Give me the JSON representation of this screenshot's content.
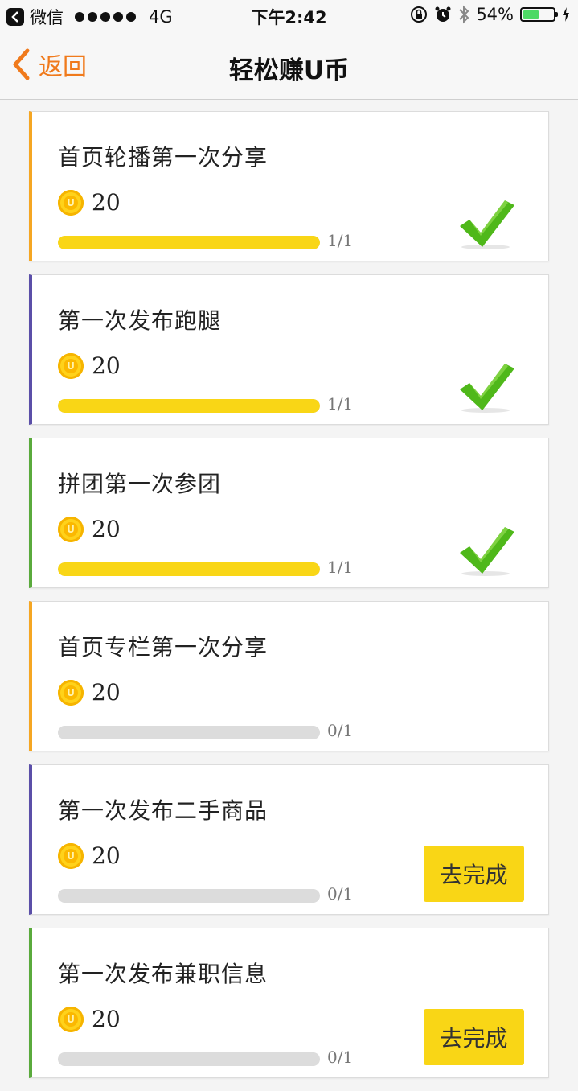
{
  "status_bar": {
    "app": "微信",
    "network": "4G",
    "time": "下午2:42",
    "battery": "54%",
    "battery_level": 0.54
  },
  "nav": {
    "back_label": "返回",
    "title": "轻松赚U币"
  },
  "tasks": [
    {
      "title": "首页轮播第一次分享",
      "reward": "20",
      "progress_text": "1/1",
      "progress": 1,
      "done": true,
      "accent": "#f5a623",
      "button": ""
    },
    {
      "title": "第一次发布跑腿",
      "reward": "20",
      "progress_text": "1/1",
      "progress": 1,
      "done": true,
      "accent": "#5b4fa8",
      "button": ""
    },
    {
      "title": "拼团第一次参团",
      "reward": "20",
      "progress_text": "1/1",
      "progress": 1,
      "done": true,
      "accent": "#5aaa3c",
      "button": ""
    },
    {
      "title": "首页专栏第一次分享",
      "reward": "20",
      "progress_text": "0/1",
      "progress": 0,
      "done": false,
      "accent": "#f5a623",
      "button": ""
    },
    {
      "title": "第一次发布二手商品",
      "reward": "20",
      "progress_text": "0/1",
      "progress": 0,
      "done": false,
      "accent": "#5b4fa8",
      "button": "去完成"
    },
    {
      "title": "第一次发布兼职信息",
      "reward": "20",
      "progress_text": "0/1",
      "progress": 0,
      "done": false,
      "accent": "#5aaa3c",
      "button": "去完成"
    }
  ],
  "colors": {
    "accent_orange": "#f07a1c",
    "progress_yellow": "#f9d616",
    "check_green": "#4fb81a"
  }
}
